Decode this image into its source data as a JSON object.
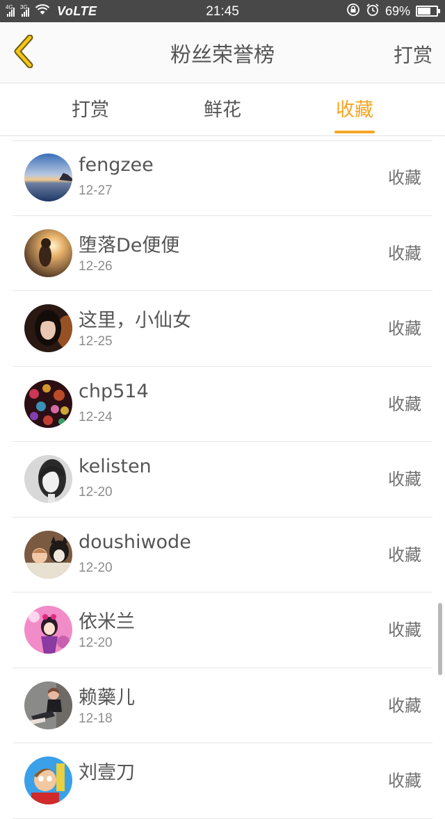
{
  "status_bar": {
    "network1": "4G",
    "network2": "3G",
    "volte": "VoLTE",
    "time": "21:45",
    "battery_percent": "69%",
    "battery_level": 0.69
  },
  "nav": {
    "title": "粉丝荣誉榜",
    "action": "打赏"
  },
  "tabs": [
    {
      "label": "打赏",
      "active": false
    },
    {
      "label": "鲜花",
      "active": false
    },
    {
      "label": "收藏",
      "active": true
    }
  ],
  "colors": {
    "accent": "#f5a623",
    "text": "#555555",
    "status_bar": "#484848"
  },
  "rows": [
    {
      "name": "fengzee",
      "date": "12-27",
      "action": "收藏",
      "avatar": "lake-sunset"
    },
    {
      "name": "堕落De便便",
      "date": "12-26",
      "action": "收藏",
      "avatar": "girl-in-sunlight"
    },
    {
      "name": "这里，小仙女",
      "date": "12-25",
      "action": "收藏",
      "avatar": "girl-portrait-dark"
    },
    {
      "name": "chp514",
      "date": "12-24",
      "action": "收藏",
      "avatar": "bokeh-lights"
    },
    {
      "name": "kelisten",
      "date": "12-20",
      "action": "收藏",
      "avatar": "bw-girl-portrait"
    },
    {
      "name": "doushiwode",
      "date": "12-20",
      "action": "收藏",
      "avatar": "baby-with-dog"
    },
    {
      "name": "依米兰",
      "date": "12-20",
      "action": "收藏",
      "avatar": "pink-cartoon-girl"
    },
    {
      "name": "赖藥儿",
      "date": "12-18",
      "action": "收藏",
      "avatar": "girl-sitting"
    },
    {
      "name": "刘壹刀",
      "date": "",
      "action": "收藏",
      "avatar": "cartoon-character"
    }
  ]
}
